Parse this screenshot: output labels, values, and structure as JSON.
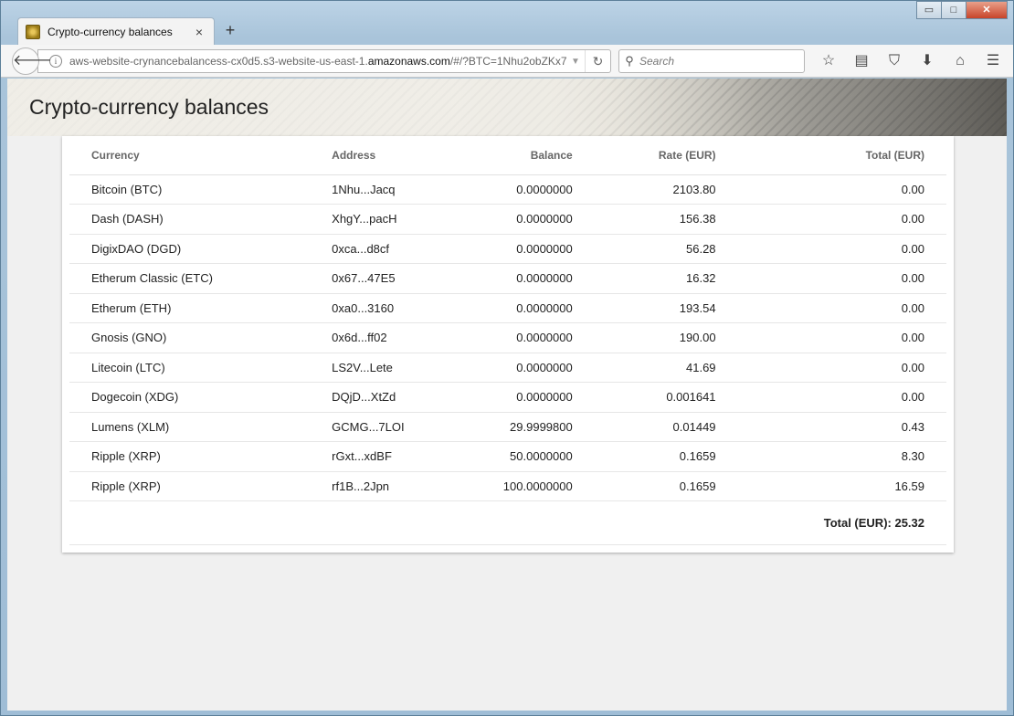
{
  "browser": {
    "tab_title": "Crypto-currency balances",
    "tab_close": "×",
    "new_tab": "+",
    "url_prefix": "aws-website-crynancebalancess-cx0d5.s3-website-us-east-1.",
    "url_domain": "amazonaws.com",
    "url_suffix": "/#/?BTC=1Nhu2obZKx7",
    "search_placeholder": "Search",
    "window_buttons": [
      "▭",
      "□",
      "✕"
    ]
  },
  "page": {
    "title": "Crypto-currency balances"
  },
  "table": {
    "headers": [
      "Currency",
      "Address",
      "Balance",
      "Rate (EUR)",
      "Total (EUR)"
    ],
    "rows": [
      [
        "Bitcoin (BTC)",
        "1Nhu...Jacq",
        "0.0000000",
        "2103.80",
        "0.00"
      ],
      [
        "Dash (DASH)",
        "XhgY...pacH",
        "0.0000000",
        "156.38",
        "0.00"
      ],
      [
        "DigixDAO (DGD)",
        "0xca...d8cf",
        "0.0000000",
        "56.28",
        "0.00"
      ],
      [
        "Etherum Classic (ETC)",
        "0x67...47E5",
        "0.0000000",
        "16.32",
        "0.00"
      ],
      [
        "Etherum (ETH)",
        "0xa0...3160",
        "0.0000000",
        "193.54",
        "0.00"
      ],
      [
        "Gnosis (GNO)",
        "0x6d...ff02",
        "0.0000000",
        "190.00",
        "0.00"
      ],
      [
        "Litecoin (LTC)",
        "LS2V...Lete",
        "0.0000000",
        "41.69",
        "0.00"
      ],
      [
        "Dogecoin (XDG)",
        "DQjD...XtZd",
        "0.0000000",
        "0.001641",
        "0.00"
      ],
      [
        "Lumens (XLM)",
        "GCMG...7LOI",
        "29.9999800",
        "0.01449",
        "0.43"
      ],
      [
        "Ripple (XRP)",
        "rGxt...xdBF",
        "50.0000000",
        "0.1659",
        "8.30"
      ],
      [
        "Ripple (XRP)",
        "rf1B...2Jpn",
        "100.0000000",
        "0.1659",
        "16.59"
      ]
    ],
    "total_label": "Total (EUR): 25.32"
  }
}
